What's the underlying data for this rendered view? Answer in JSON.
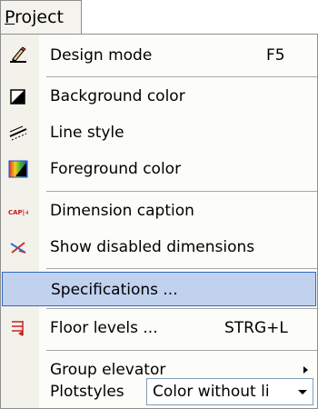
{
  "menubar": {
    "menu_title_access": "P",
    "menu_title_rest": "roject"
  },
  "menu": {
    "items": [
      {
        "label": "Design mode",
        "shortcut": "F5",
        "icon": "design-mode-icon"
      },
      {
        "label": "Background color",
        "icon": "background-color-icon"
      },
      {
        "label": "Line style",
        "icon": "line-style-icon"
      },
      {
        "label": "Foreground color",
        "icon": "foreground-color-icon"
      },
      {
        "label": "Dimension caption",
        "icon": "dimension-caption-icon",
        "icon_text": "CAP|+"
      },
      {
        "label": "Show disabled dimensions",
        "icon": "disabled-dimensions-icon"
      },
      {
        "label": "Specifications ...",
        "icon": ""
      },
      {
        "label": "Floor levels ...",
        "shortcut": "STRG+L",
        "icon": "floor-levels-icon"
      },
      {
        "label": "Group elevator",
        "icon": ""
      },
      {
        "label": "Plotstyles",
        "icon": ""
      }
    ],
    "plotstyles_value": "Color without li",
    "highlighted_item": "Specifications ..."
  },
  "colors": {
    "highlight_bg": "#c1d2ee",
    "highlight_border": "#316ac5",
    "gutter": "#f2f1ea"
  }
}
